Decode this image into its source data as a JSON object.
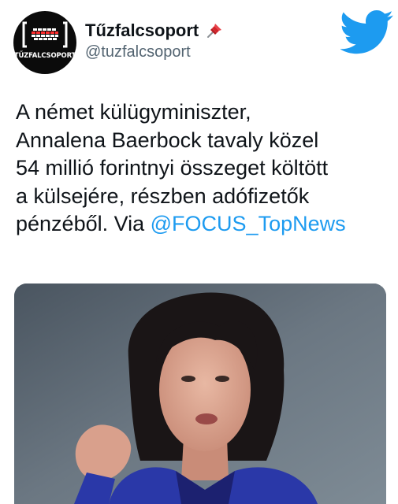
{
  "author": {
    "name": "Tűzfalcsoport",
    "handle": "@tuzfalcsoport",
    "avatar_text": "TŰZFALCSOPORT",
    "avatar_icon": "brick-wall-bracket-logo",
    "pin_icon": "pushpin-icon"
  },
  "brand_icon": "twitter-bird-icon",
  "tweet": {
    "lines": [
      "A német külügyminiszter,",
      "Annalena Baerbock tavaly közel",
      "54 millió forintnyi összeget költött",
      "a külsejére, részben adófizetők"
    ],
    "last_line_prefix": "pénzéből. Via ",
    "mention": "@FOCUS_TopNews"
  },
  "media": {
    "type": "photo",
    "subject": "woman-speaking-photo"
  },
  "colors": {
    "link": "#1d9bf0",
    "twitter_blue": "#1d9bf0",
    "handle_gray": "#536471",
    "pin_red": "#d3232a"
  }
}
